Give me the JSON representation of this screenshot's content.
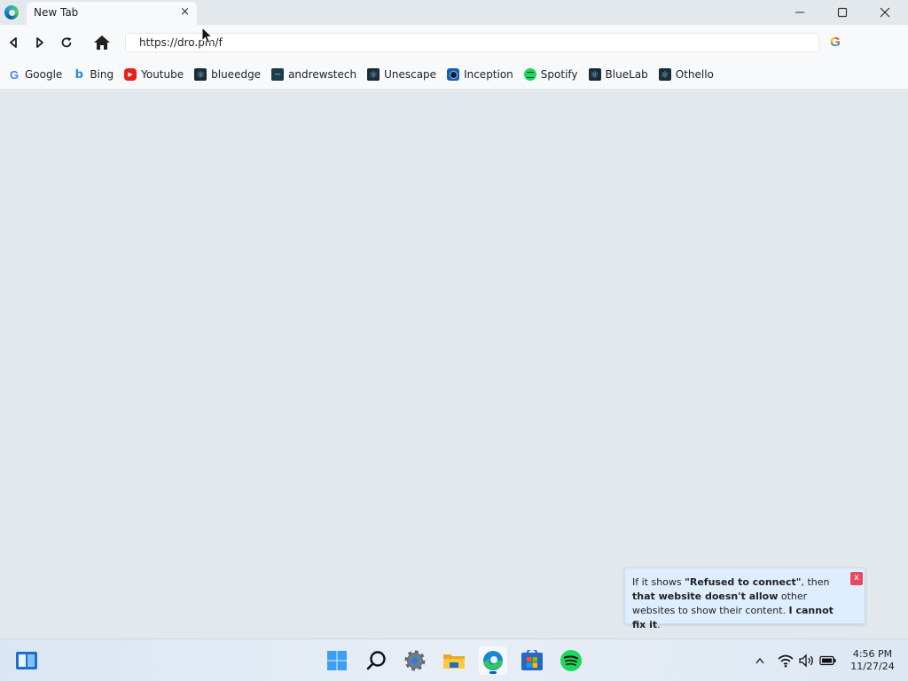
{
  "window": {
    "tab_title": "New Tab",
    "tab_close": "×",
    "minimize": "─",
    "maximize": "☐",
    "close": "✕"
  },
  "toolbar": {
    "back_icon": "back-icon",
    "forward_icon": "forward-icon",
    "reload_icon": "reload-icon",
    "home_icon": "home-icon",
    "address_value": "https://dro.pm/f",
    "google_icon": "G"
  },
  "bookmarks": [
    {
      "label": "Google",
      "icon": "google-icon",
      "glyph": "G"
    },
    {
      "label": "Bing",
      "icon": "bing-icon",
      "glyph": "b"
    },
    {
      "label": "Youtube",
      "icon": "youtube-icon",
      "glyph": "▶"
    },
    {
      "label": "blueedge",
      "icon": "react-icon",
      "glyph": "⚛"
    },
    {
      "label": "andrewstech",
      "icon": "andrewstech-icon",
      "glyph": "~"
    },
    {
      "label": "Unescape",
      "icon": "react-icon",
      "glyph": "⚛"
    },
    {
      "label": "Inception",
      "icon": "inception-icon",
      "glyph": ""
    },
    {
      "label": "Spotify",
      "icon": "spotify-icon",
      "glyph": ""
    },
    {
      "label": "BlueLab",
      "icon": "react-icon",
      "glyph": "⚛"
    },
    {
      "label": "Othello",
      "icon": "react-icon",
      "glyph": "⚛"
    }
  ],
  "notice": {
    "part1": "If it shows ",
    "bold1": "\"Refused to connect\"",
    "part2": ", then ",
    "bold2": "that website doesn't allow",
    "part3": " other websites to show their content. ",
    "bold3": "I cannot fix it",
    "part4": ".",
    "close_label": "x"
  },
  "taskbar": {
    "apps": [
      "widgets-icon",
      "start-icon",
      "search-icon",
      "settings-icon",
      "file-explorer-icon",
      "edge-icon",
      "store-icon",
      "spotify-icon"
    ],
    "active_app": "edge-icon",
    "time": "4:56 PM",
    "date": "11/27/24"
  },
  "colors": {
    "background": "#e3e8ec",
    "toolbar": "#f7f9fa",
    "notice_bg": "#dfeefe",
    "notice_close": "#e84a5f",
    "accent": "#0067c0"
  }
}
